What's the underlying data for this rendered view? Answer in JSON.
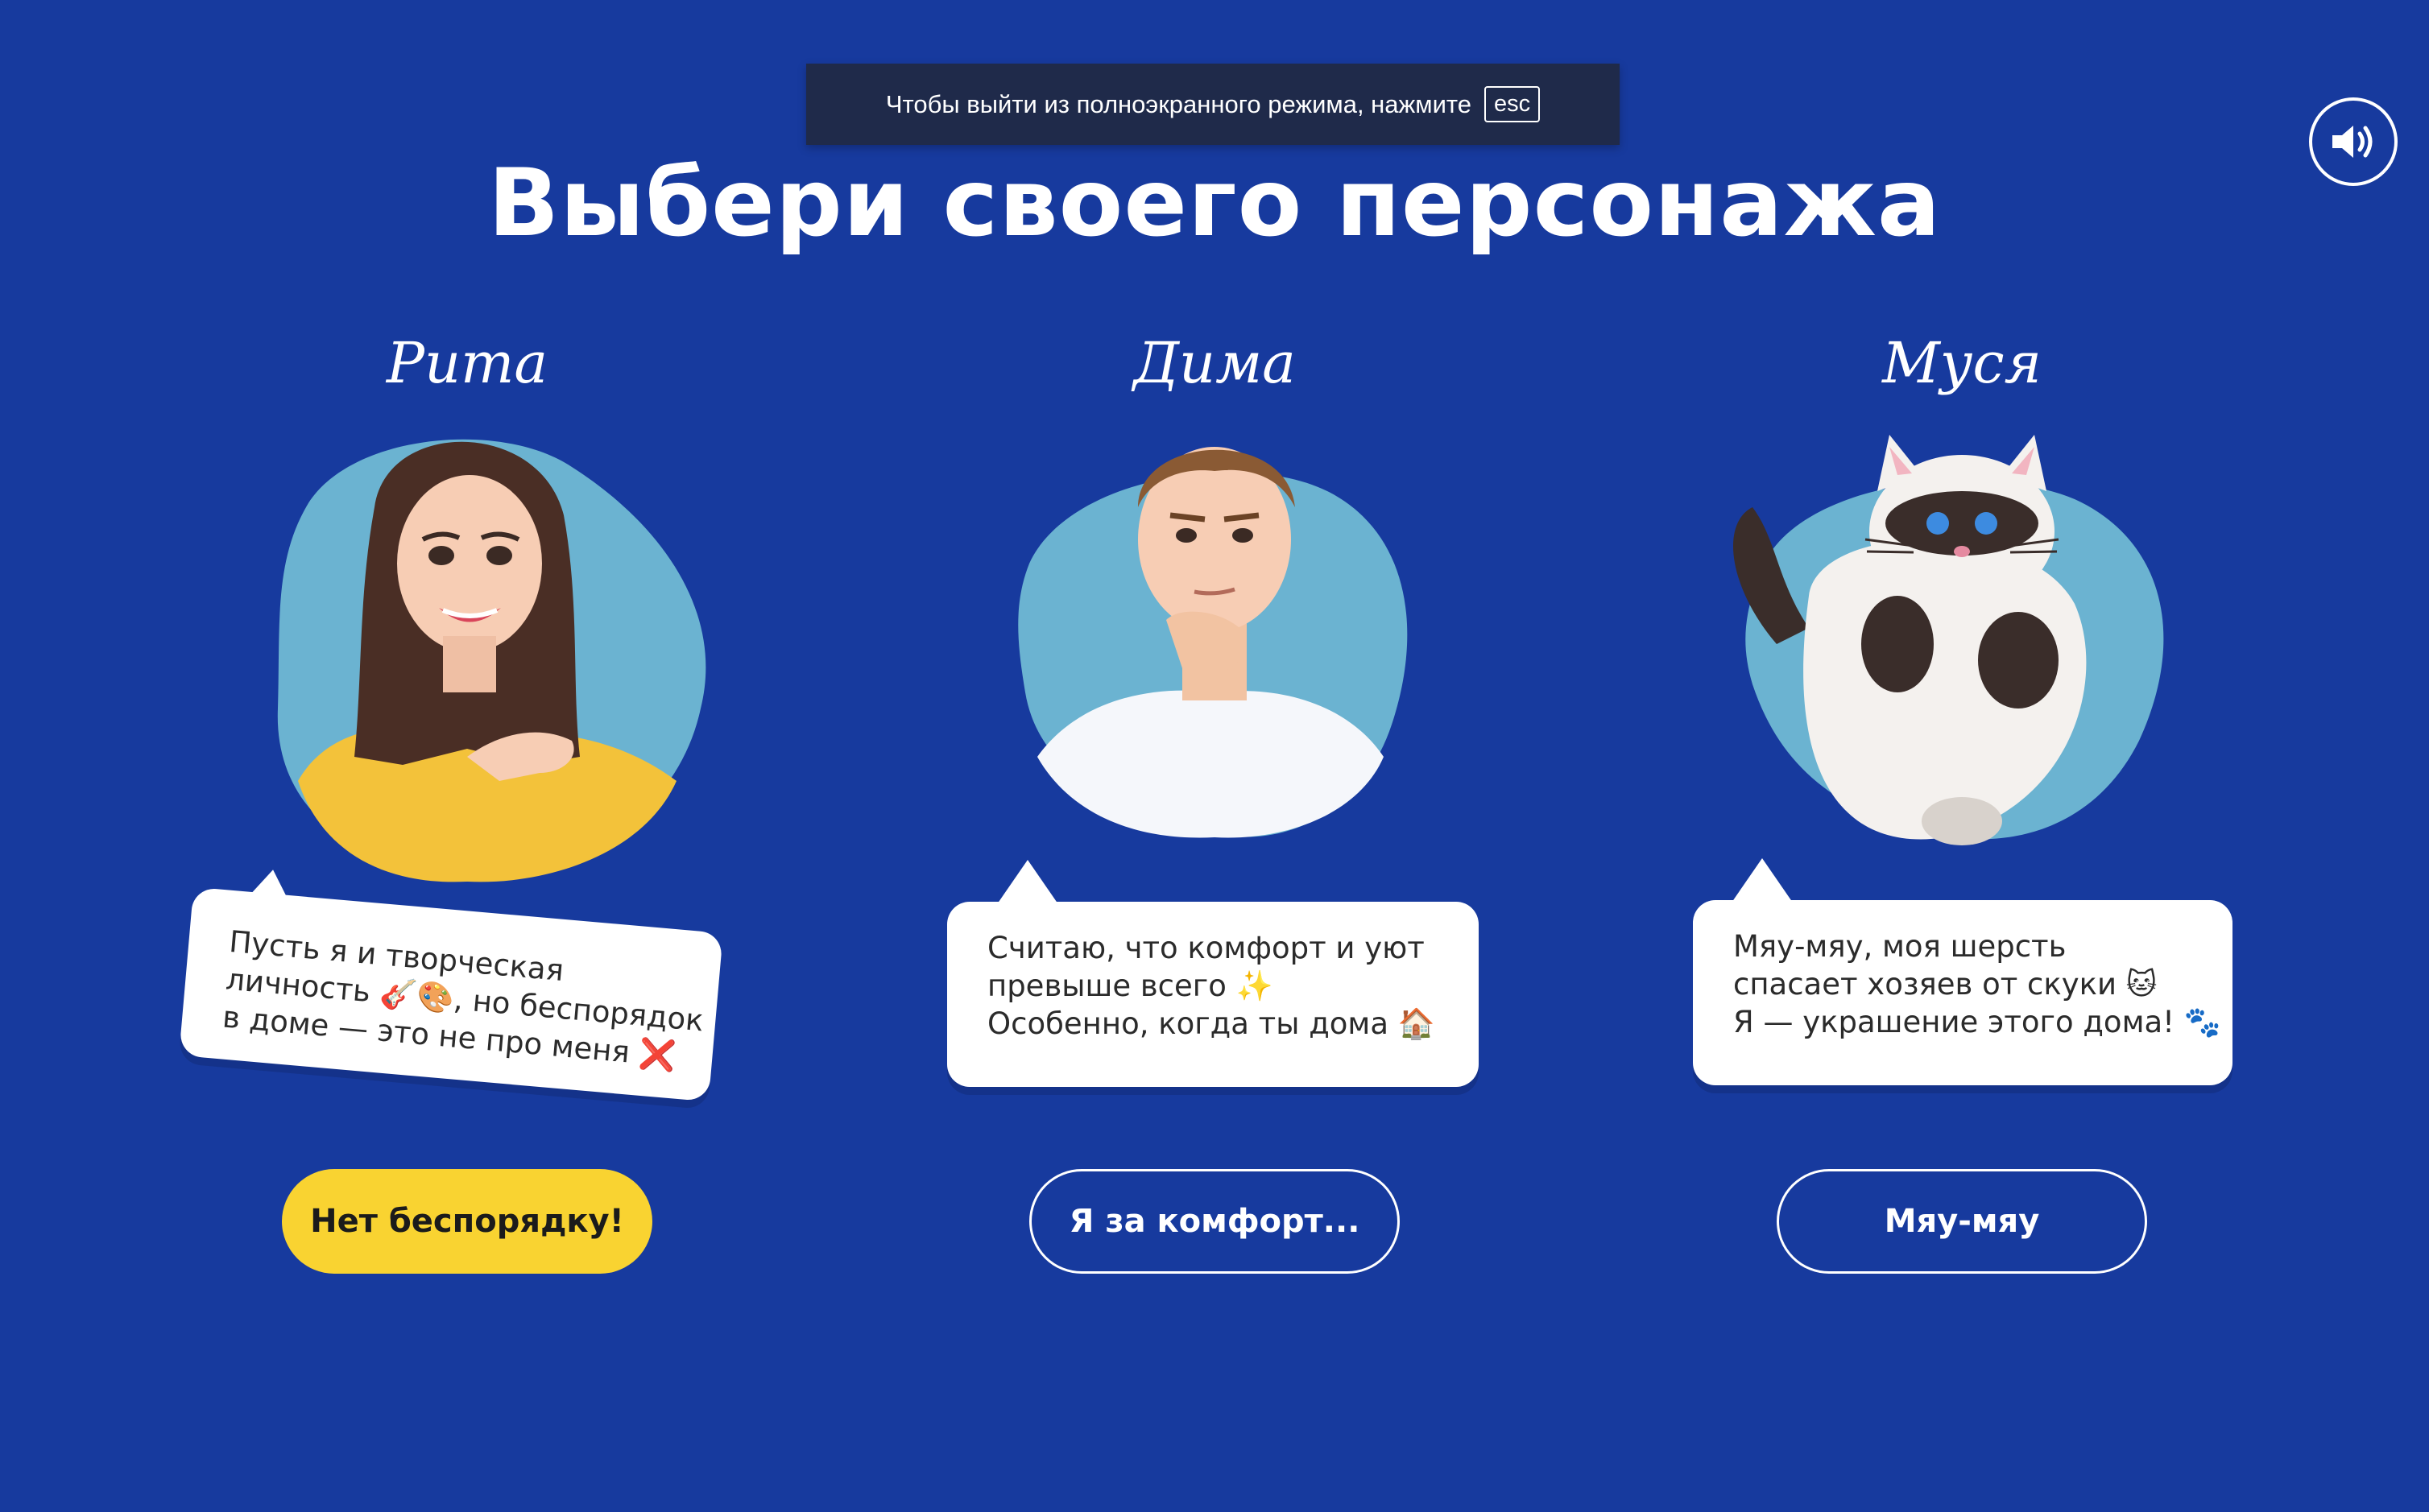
{
  "fullscreen_notice": {
    "text": "Чтобы выйти из полноэкранного режима, нажмите",
    "key": "esc"
  },
  "sound_button": {
    "icon": "speaker-volume-icon"
  },
  "title": "Выбери своего персонажа",
  "characters": [
    {
      "name": "Рита",
      "bubble": [
        "Пусть я и творческая",
        "личность 🎸🎨, но беспорядок",
        "в доме — это не про меня ❌"
      ],
      "button": "Нет беспорядку!"
    },
    {
      "name": "Дима",
      "bubble": [
        "Считаю, что комфорт и уют",
        "превыше всего ✨",
        "Особенно, когда ты дома 🏠"
      ],
      "button": "Я за комфорт..."
    },
    {
      "name": "Муся",
      "bubble": [
        "Мяу-мяу, моя шерсть",
        "спасает хозяев от скуки 🐱",
        "Я — украшение этого дома! 🐾"
      ],
      "button": "Мяу-мяу"
    }
  ],
  "colors": {
    "background": "#173a9e",
    "blob": "#6bb3d1",
    "primary_button": "#f9d331",
    "toast": "#1f2a4a"
  }
}
